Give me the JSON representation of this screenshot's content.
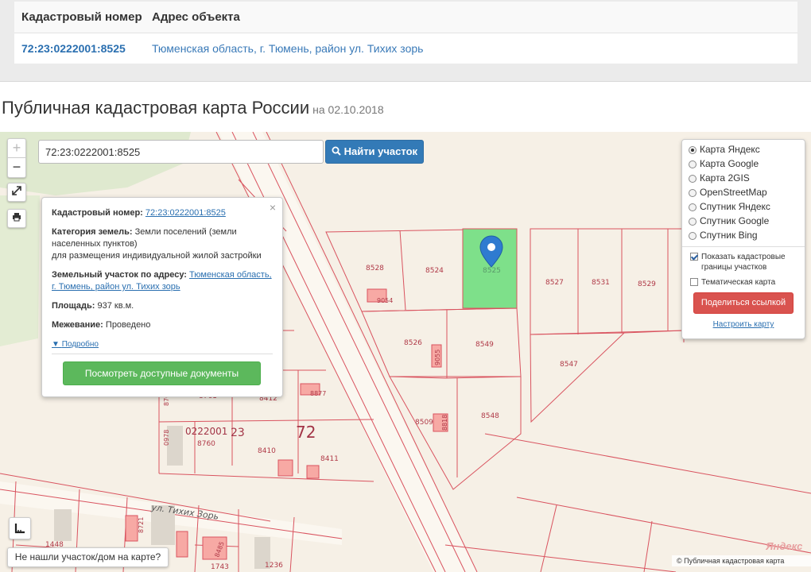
{
  "table": {
    "col_number": "Кадастровый номер",
    "col_address": "Адрес объекта",
    "row_number": "72:23:0222001:8525",
    "row_address": "Тюменская область, г. Тюмень, район ул. Тихих зорь"
  },
  "heading": {
    "title": "Публичная кадастровая карта России",
    "date": "на 02.10.2018"
  },
  "map": {
    "zoom_in": "+",
    "zoom_out": "−",
    "fullscreen_icon": "expand-icon",
    "print_icon": "printer-icon",
    "ruler_icon": "ruler-icon",
    "search_value": "72:23:0222001:8525",
    "search_button": "Найти участок",
    "search_icon": "magnifier-icon",
    "popup": {
      "close": "×",
      "cad_label": "Кадастровый номер:",
      "cad_value": "72:23:0222001:8525",
      "category_label": "Категория земель:",
      "category_value": "Земли поселений (земли населенных пунктов)",
      "usage_value": "для размещения индивидуальной жилой застройки",
      "address_label": "Земельный участок по адресу:",
      "address_value": "Тюменская область, г. Тюмень, район ул. Тихих зорь",
      "area_label": "Площадь:",
      "area_value": "937 кв.м.",
      "survey_label": "Межевание:",
      "survey_value": "Проведено",
      "more": "Подробно",
      "docs_button": "Посмотреть доступные документы"
    },
    "layers": [
      {
        "label": "Карта Яндекс",
        "selected": true
      },
      {
        "label": "Карта Google",
        "selected": false
      },
      {
        "label": "Карта 2GIS",
        "selected": false
      },
      {
        "label": "OpenStreetMap",
        "selected": false
      },
      {
        "label": "Спутник Яндекс",
        "selected": false
      },
      {
        "label": "Спутник Google",
        "selected": false
      },
      {
        "label": "Спутник Bing",
        "selected": false
      }
    ],
    "show_borders_label": "Показать кадастровые границы участков",
    "show_borders_checked": true,
    "thematic_label": "Тематическая карта",
    "thematic_checked": false,
    "share_button": "Поделиться ссылкой",
    "configure_link": "Настроить карту",
    "not_found": "Не нашли участок/дом на карте?",
    "copyright": "© Публичная кадастровая карта",
    "yandex": "Яндекс",
    "street": "ул. Тихих Зорь",
    "quarter": "0222001",
    "district": "23",
    "region": "72",
    "parcels": [
      "8528",
      "8524",
      "8525",
      "8527",
      "8531",
      "8529",
      "9054",
      "8526",
      "9055",
      "8549",
      "8547",
      "8509",
      "8818",
      "8548",
      "8761",
      "8412",
      "8877",
      "8760",
      "8410",
      "8411",
      "1448",
      "1743",
      "1236",
      "8485",
      "8721",
      "0978",
      "876"
    ],
    "colors": {
      "selected_parcel": "#7ee08a",
      "marker": "#2f7bd0",
      "border": "#d9535f"
    }
  }
}
